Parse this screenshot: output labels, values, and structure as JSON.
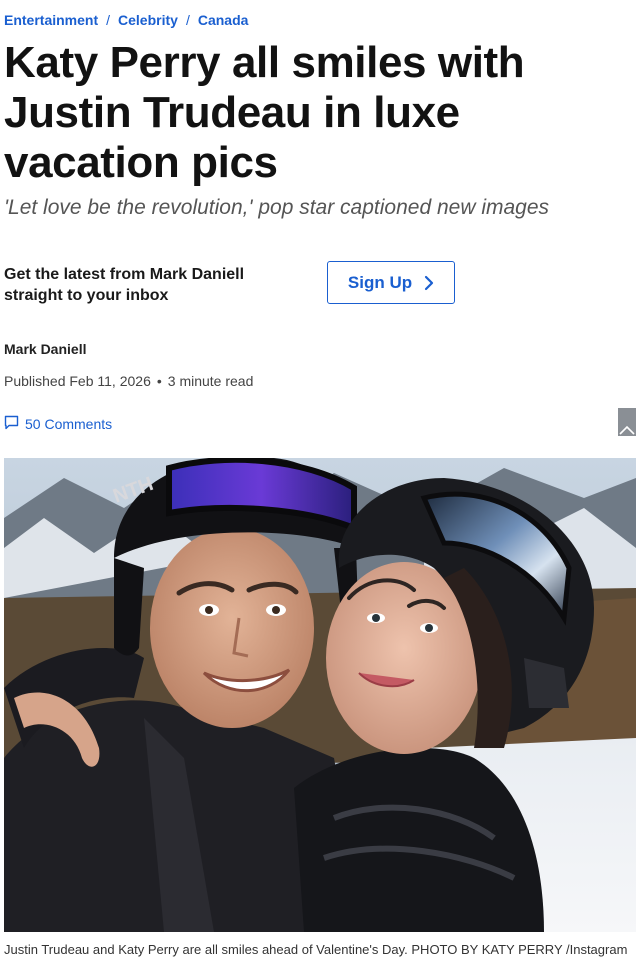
{
  "breadcrumb": {
    "items": [
      "Entertainment",
      "Celebrity",
      "Canada"
    ],
    "separator": "/"
  },
  "headline": "Katy Perry all smiles with Justin Trudeau in luxe vacation pics",
  "deck": "'Let love be the revolution,' pop star captioned new images",
  "signup": {
    "text": "Get the latest from Mark Daniell straight to your inbox",
    "button_label": "Sign Up"
  },
  "byline": {
    "author": "Mark Daniell",
    "published": "Published Feb 11, 2026",
    "separator": "•",
    "read_time": "3 minute read"
  },
  "comments": {
    "label": "50 Comments",
    "icon": "comment-icon"
  },
  "bookmark": {
    "icon": "bookmark-icon"
  },
  "photo": {
    "helmet_text": "NTH"
  },
  "caption": "Justin Trudeau and Katy Perry are all smiles ahead of Valentine's Day. PHOTO BY KATY PERRY /Instagram",
  "colors": {
    "link": "#1a5fd0",
    "headline": "#121212",
    "deck": "#555555"
  }
}
